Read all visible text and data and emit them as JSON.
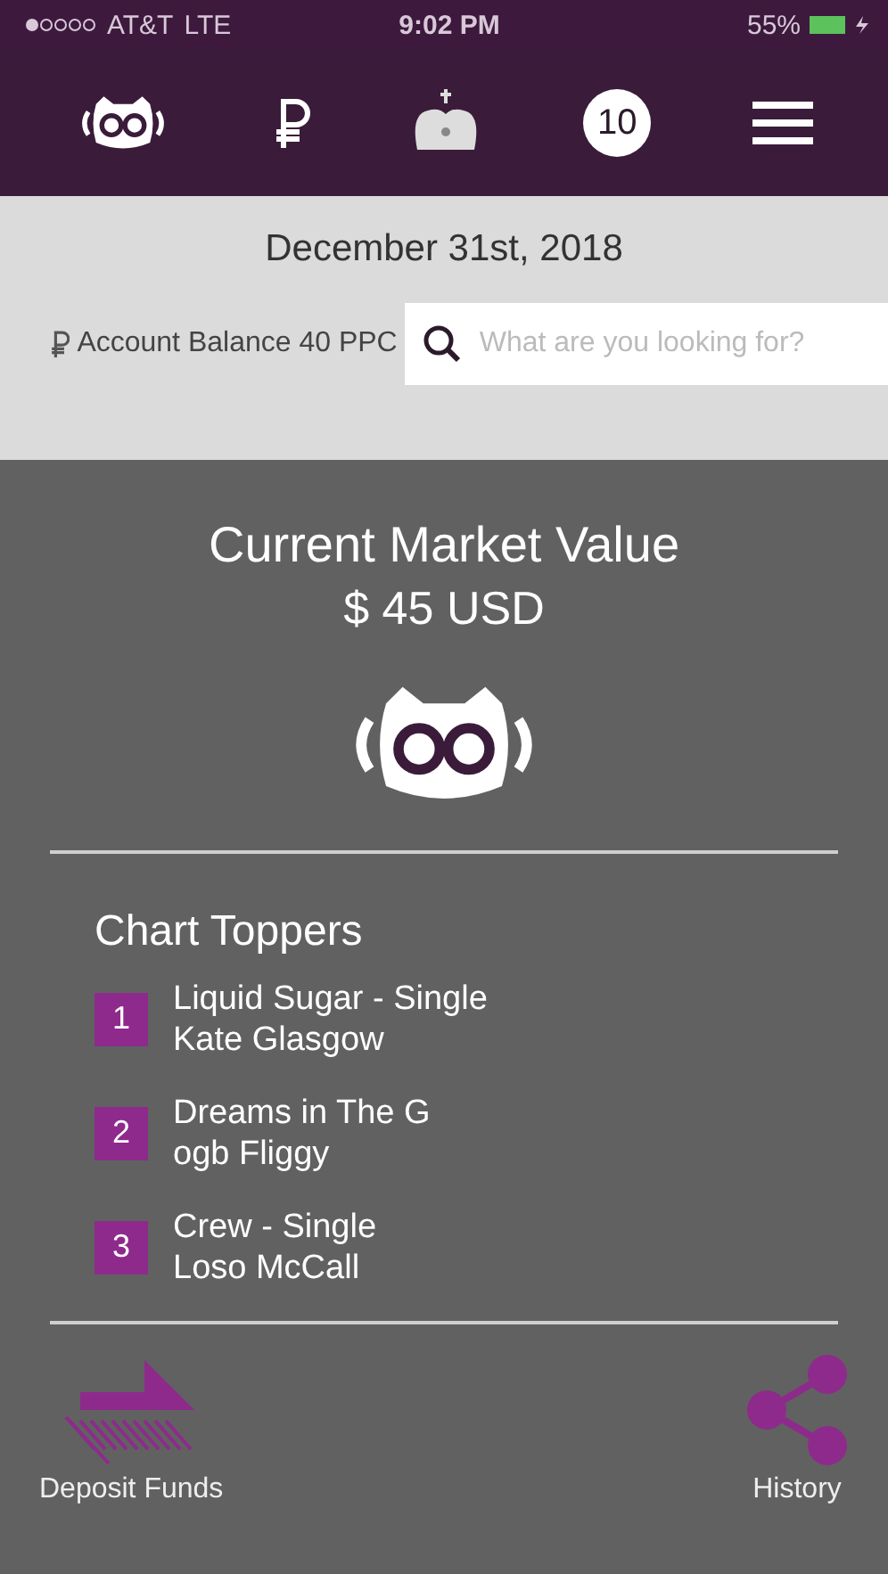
{
  "status_bar": {
    "carrier": "AT&T",
    "network": "LTE",
    "time": "9:02 PM",
    "battery": "55%"
  },
  "nav": {
    "notification_count": "10"
  },
  "date": "December 31st, 2018",
  "balance": {
    "label": "Account Balance 40 PPC"
  },
  "search": {
    "placeholder": "What are you looking for?"
  },
  "market": {
    "title": "Current Market Value",
    "value": "$ 45 USD"
  },
  "chart_toppers": {
    "title": "Chart Toppers",
    "items": [
      {
        "rank": "1",
        "title": "Liquid Sugar - Single",
        "artist": "Kate Glasgow"
      },
      {
        "rank": "2",
        "title": "Dreams in The G",
        "artist": "ogb Fliggy"
      },
      {
        "rank": "3",
        "title": "Crew - Single",
        "artist": "Loso McCall"
      }
    ]
  },
  "actions": [
    {
      "kind": "deposit",
      "label": "Deposit Funds"
    },
    {
      "kind": "history",
      "label": "History"
    }
  ]
}
